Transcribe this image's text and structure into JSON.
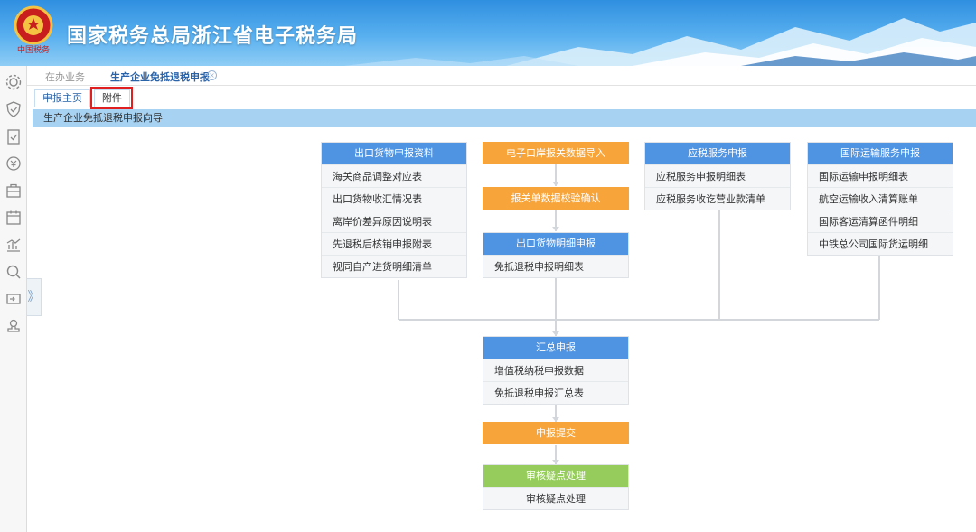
{
  "header": {
    "title": "国家税务总局浙江省电子税务局"
  },
  "sidebar": {
    "icons": [
      "gear-icon",
      "shield-check-icon",
      "clipboard-check-icon",
      "refund-icon",
      "briefcase-icon",
      "calendar-icon",
      "chart-icon",
      "search-icon",
      "ticket-icon",
      "user-stamp-icon"
    ],
    "expand_glyph": "》"
  },
  "tabs": {
    "inactive_label": "在办业务",
    "active_label": "生产企业免抵退税申报",
    "close_glyph": "×"
  },
  "subtabs": {
    "main_label": "申报主页",
    "attachment_label": "附件"
  },
  "guide_title": "生产企业免抵退税申报向导",
  "flow": {
    "export_goods": {
      "title": "出口货物申报资料",
      "items": [
        "海关商品调整对应表",
        "出口货物收汇情况表",
        "离岸价差异原因说明表",
        "先退税后核销申报附表",
        "视同自产进货明细清单"
      ]
    },
    "customs_import": "电子口岸报关数据导入",
    "customs_verify": "报关单数据校验确认",
    "export_detail": {
      "title": "出口货物明细申报",
      "items": [
        "免抵退税申报明细表"
      ]
    },
    "taxable_service": {
      "title": "应税服务申报",
      "items": [
        "应税服务申报明细表",
        "应税服务收讫营业款清单"
      ]
    },
    "intl_transport": {
      "title": "国际运输服务申报",
      "items": [
        "国际运输申报明细表",
        "航空运输收入清算账单",
        "国际客运清算函件明细",
        "中铁总公司国际货运明细"
      ]
    },
    "summary": {
      "title": "汇总申报",
      "items": [
        "增值税纳税申报数据",
        "免抵退税申报汇总表"
      ]
    },
    "submit": "申报提交",
    "review": {
      "title": "审核疑点处理",
      "items": [
        "审核疑点处理"
      ]
    }
  },
  "colors": {
    "header_blue": "#2f8fe0",
    "box_blue": "#4f94e3",
    "box_orange": "#f7a43a",
    "box_green": "#95cc5b",
    "highlight_red": "#e02020"
  }
}
